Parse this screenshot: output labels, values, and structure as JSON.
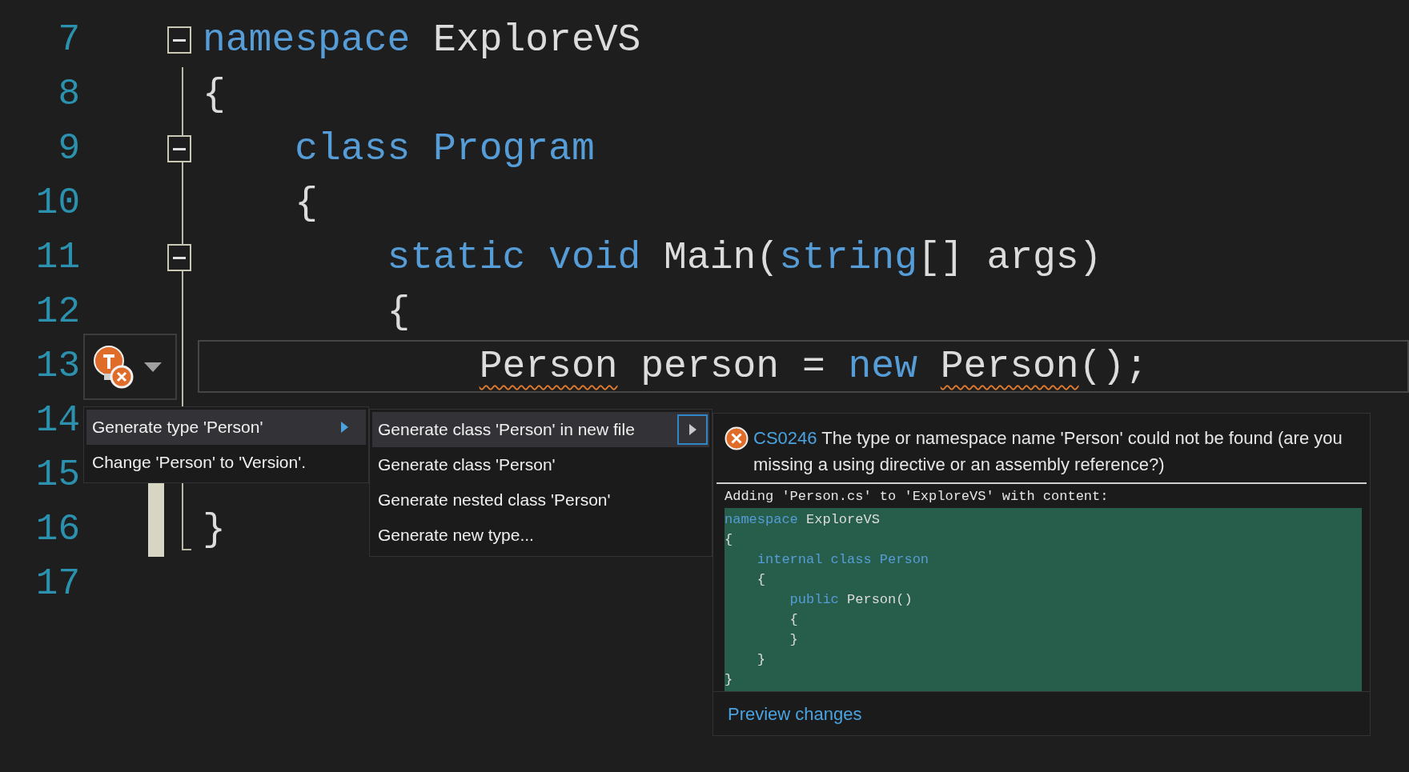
{
  "editor": {
    "lines": [
      {
        "number": "7",
        "current": false,
        "changed": false,
        "expanded": true,
        "tokens": [
          {
            "text": "namespace",
            "kind": "keyword",
            "error": false
          },
          {
            "text": " ExploreVS",
            "kind": "identifier",
            "error": false
          }
        ]
      },
      {
        "number": "8",
        "current": false,
        "changed": false,
        "tokens": [
          {
            "text": "{",
            "kind": "identifier",
            "error": false
          }
        ]
      },
      {
        "number": "9",
        "current": false,
        "changed": false,
        "expanded": true,
        "tokens": [
          {
            "text": "    class Program",
            "kind": "keyword",
            "error": false
          }
        ]
      },
      {
        "number": "10",
        "current": false,
        "changed": false,
        "tokens": [
          {
            "text": "    {",
            "kind": "identifier",
            "error": false
          }
        ]
      },
      {
        "number": "11",
        "current": false,
        "changed": false,
        "expanded": true,
        "tokens": [
          {
            "text": "        static void",
            "kind": "keyword",
            "error": false
          },
          {
            "text": " Main(",
            "kind": "identifier",
            "error": false
          },
          {
            "text": "string",
            "kind": "keyword",
            "error": false
          },
          {
            "text": "[] args)",
            "kind": "identifier",
            "error": false
          }
        ]
      },
      {
        "number": "12",
        "current": false,
        "changed": false,
        "tokens": [
          {
            "text": "        {",
            "kind": "identifier",
            "error": false
          }
        ]
      },
      {
        "number": "13",
        "current": true,
        "changed": false,
        "tokens": [
          {
            "text": "            Person",
            "kind": "identifier",
            "error": true
          },
          {
            "text": " person = ",
            "kind": "identifier",
            "error": false
          },
          {
            "text": "new",
            "kind": "keyword",
            "error": false
          },
          {
            "text": " Person",
            "kind": "identifier",
            "error": true
          },
          {
            "text": "();",
            "kind": "identifier",
            "error": false
          }
        ]
      },
      {
        "number": "14",
        "current": false,
        "changed": false
      },
      {
        "number": "15",
        "current": false,
        "changed": true
      },
      {
        "number": "16",
        "current": false,
        "changed": true,
        "tokens": [
          {
            "text": "}",
            "kind": "identifier",
            "error": false
          }
        ]
      },
      {
        "number": "17",
        "current": false,
        "changed": false
      }
    ]
  },
  "quick_actions": {
    "items": [
      {
        "label": "Generate type 'Person'",
        "selected": true,
        "has_submenu": true
      },
      {
        "label": "Change 'Person' to 'Version'.",
        "selected": false,
        "has_submenu": false
      }
    ]
  },
  "submenu": {
    "items": [
      {
        "label": "Generate class 'Person' in new file",
        "selected": true,
        "has_submenu": true
      },
      {
        "label": "Generate class 'Person'",
        "selected": false,
        "has_submenu": false
      },
      {
        "label": "Generate nested class 'Person'",
        "selected": false,
        "has_submenu": false
      },
      {
        "label": "Generate new type...",
        "selected": false,
        "has_submenu": false
      }
    ]
  },
  "preview": {
    "error_code": "CS0246",
    "message": "The type or namespace name 'Person' could not be found (are you missing a using directive or an assembly reference?)",
    "summary": "Adding 'Person.cs' to 'ExploreVS' with content:",
    "code_lines": [
      [
        {
          "text": "namespace",
          "kind": "keyword"
        },
        {
          "text": " ExploreVS",
          "kind": "identifier"
        }
      ],
      [
        {
          "text": "{",
          "kind": "identifier"
        }
      ],
      [
        {
          "text": "    internal class Person",
          "kind": "keyword"
        }
      ],
      [
        {
          "text": "    {",
          "kind": "identifier"
        }
      ],
      [
        {
          "text": "        public",
          "kind": "keyword"
        },
        {
          "text": " Person()",
          "kind": "identifier"
        }
      ],
      [
        {
          "text": "        {",
          "kind": "identifier"
        }
      ],
      [
        {
          "text": "        }",
          "kind": "identifier"
        }
      ],
      [
        {
          "text": "    }",
          "kind": "identifier"
        }
      ],
      [
        {
          "text": "}",
          "kind": "identifier"
        }
      ]
    ],
    "link": "Preview changes"
  }
}
